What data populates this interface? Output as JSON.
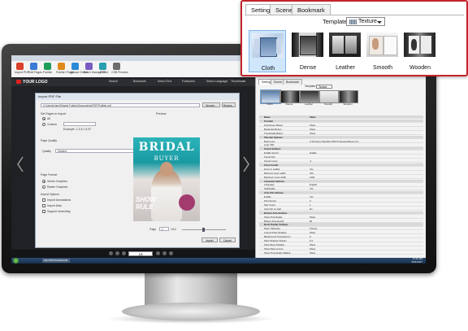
{
  "callout": {
    "tabs": [
      {
        "label": "Setting",
        "active": true
      },
      {
        "label": "Scene",
        "active": false
      },
      {
        "label": "Bookmark",
        "active": false
      }
    ],
    "template_label": "Template:",
    "template_value": "Texture",
    "tiles": [
      {
        "label": "Cloth",
        "selected": true
      },
      {
        "label": "Dense",
        "selected": false
      },
      {
        "label": "Leather",
        "selected": false
      },
      {
        "label": "Smooth",
        "selected": false
      },
      {
        "label": "Wooden",
        "selected": false
      }
    ]
  },
  "app": {
    "toolbar": [
      {
        "label": "Import PDF",
        "color": "#d9412b"
      },
      {
        "label": "Edit Pages",
        "color": "#3a7bd5"
      },
      {
        "label": "Publish",
        "color": "#1e9e5a"
      },
      {
        "label": "Publish Plugin",
        "color": "#e08a1e"
      },
      {
        "label": "Upload Online",
        "color": "#2b8bd6"
      },
      {
        "label": "Batch Management",
        "color": "#7a5bc2"
      },
      {
        "label": "FTP",
        "color": "#2a9fb0"
      },
      {
        "label": "CSB Preview",
        "color": "#6c6c6c"
      }
    ],
    "logo_text": "YOUR LOGO",
    "nav_items": [
      "Search",
      "Bookmark",
      "Select Text",
      "Fullscreen",
      "Select Language",
      "Thumbnails"
    ],
    "dialog": {
      "title": "Import PDF File",
      "path": "C:\\Users\\User\\Shared Folders\\Documents\\PDF\\Publish.pdf",
      "browse": "Browse...",
      "preview_label": "Preview",
      "pages_label": "Set Pages to Import",
      "all": "All",
      "custom": "Custom",
      "example": "Example: 1,3-5,7,9,97",
      "quality_section": "Page Quality",
      "quality_label": "Quality",
      "quality_value": "Highest",
      "format_section": "Page Format",
      "vector": "Vector Graphics",
      "raster": "Raster Graphics",
      "import_options": "Import Options",
      "opt1": "Import Annotations",
      "opt2": "Import links",
      "opt3": "Support searching",
      "page_label": "Page",
      "page_value": "1",
      "page_total": "1/12",
      "import_btn": "Import",
      "cancel_btn": "Cancel"
    },
    "cover": {
      "title": "BRIDAL",
      "subtitle": "BUYER",
      "show": "SHOW",
      "show2": "RULE"
    },
    "pager_value": "1/8",
    "taskbar_item": "Flip PDF Professional",
    "clock_time": "11:11 AM",
    "clock_date": "5/31/2017",
    "rpane": {
      "tabs": [
        "Setting",
        "Scene",
        "Bookmark"
      ],
      "template_label": "Template:",
      "template_value": "Texture",
      "tiles": [
        "Cloth",
        "Dense",
        "Leather",
        "Smooth",
        "Wooden"
      ],
      "col_name": "Name",
      "col_value": "Value",
      "props": [
        {
          "k": "Tool Bar",
          "v": "",
          "g": true
        },
        {
          "k": "Full Screen Button",
          "v": "Show",
          "g": false
        },
        {
          "k": "Bookmark Button",
          "v": "Show",
          "g": false
        },
        {
          "k": "Thumbnails Button",
          "v": "Show",
          "g": false
        },
        {
          "k": "Title Bar Settings",
          "v": "",
          "g": true
        },
        {
          "k": "Book Logo",
          "v": "C:\\Program Files\\Flip PDF Professional\\logo.png",
          "g": false
        },
        {
          "k": "Logo URL",
          "v": "",
          "g": false
        },
        {
          "k": "Sound Settings",
          "v": "",
          "g": true
        },
        {
          "k": "Enable Sound",
          "v": "Enable",
          "g": false
        },
        {
          "k": "Sound File",
          "v": "",
          "g": false
        },
        {
          "k": "Sound Loops",
          "v": "-1",
          "g": false
        },
        {
          "k": "Zoom Config",
          "v": "",
          "g": true
        },
        {
          "k": "Zoom in enable",
          "v": "Yes",
          "g": false
        },
        {
          "k": "Minimum zoom width",
          "v": "700",
          "g": false
        },
        {
          "k": "Maximum zoom width",
          "v": "1400",
          "g": false
        },
        {
          "k": "Language Settings",
          "v": "",
          "g": true
        },
        {
          "k": "Language",
          "v": "English",
          "g": false
        },
        {
          "k": "Switchable",
          "v": "Yes",
          "g": false
        },
        {
          "k": "Auto Flip Settings",
          "v": "",
          "g": true
        },
        {
          "k": "Enable",
          "v": "Yes",
          "g": false
        },
        {
          "k": "Flip Interval",
          "v": "3",
          "g": false
        },
        {
          "k": "Play Count",
          "v": "1",
          "g": false
        },
        {
          "k": "Auto Flip on start",
          "v": "No",
          "g": false
        },
        {
          "k": "Bottom Area Settings",
          "v": "",
          "g": true
        },
        {
          "k": "Show Thumbnails",
          "v": "Show",
          "g": false
        },
        {
          "k": "Bottom Area Height",
          "v": "60",
          "g": false
        },
        {
          "k": "Book Display Settings",
          "v": "",
          "g": true
        },
        {
          "k": "Page Thickness",
          "v": "Thinner",
          "g": false
        },
        {
          "k": "Current Page Shadow",
          "v": "Show",
          "g": false
        },
        {
          "k": "Background Transparency",
          "v": "0",
          "g": false
        },
        {
          "k": "Page Shadow Opacity",
          "v": "0.3",
          "g": false
        },
        {
          "k": "Show Book Shadow",
          "v": "Show",
          "g": false
        },
        {
          "k": "Show Page Corner",
          "v": "Show",
          "g": false
        },
        {
          "k": "Show Thumbnails Sidebar",
          "v": "Show",
          "g": false
        }
      ]
    }
  }
}
